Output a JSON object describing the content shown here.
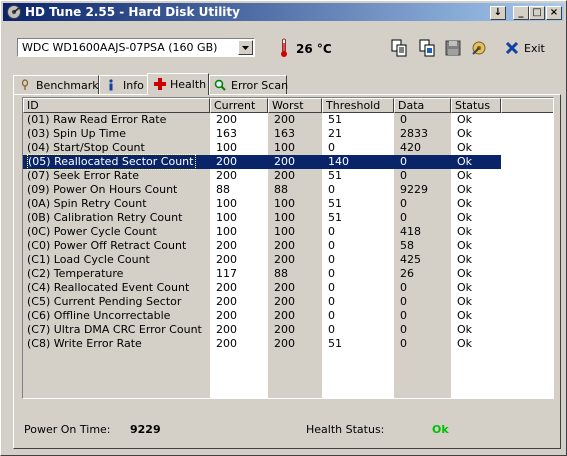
{
  "window": {
    "title": "HD Tune 2.55 - Hard Disk Utility",
    "buttons": [
      "↓",
      "_",
      "□",
      "×"
    ]
  },
  "toolbar": {
    "drive": "WDC WD1600AAJS-07PSA (160 GB)",
    "temperature": "26 °C",
    "exit_label": "Exit",
    "icons": [
      "copy-text-icon",
      "copy-screenshot-icon",
      "save-icon",
      "options-icon"
    ]
  },
  "tabs": [
    {
      "label": "Benchmark",
      "icon": "benchmark-icon"
    },
    {
      "label": "Info",
      "icon": "info-icon"
    },
    {
      "label": "Health",
      "icon": "health-icon",
      "active": true
    },
    {
      "label": "Error Scan",
      "icon": "error-scan-icon"
    }
  ],
  "table": {
    "headers": [
      "ID",
      "Current",
      "Worst",
      "Threshold",
      "Data",
      "Status"
    ],
    "selected_index": 3,
    "rows": [
      [
        "(01) Raw Read Error Rate",
        "200",
        "200",
        "51",
        "0",
        "Ok"
      ],
      [
        "(03) Spin Up Time",
        "163",
        "163",
        "21",
        "2833",
        "Ok"
      ],
      [
        "(04) Start/Stop Count",
        "100",
        "100",
        "0",
        "420",
        "Ok"
      ],
      [
        "(05) Reallocated Sector Count",
        "200",
        "200",
        "140",
        "0",
        "Ok"
      ],
      [
        "(07) Seek Error Rate",
        "200",
        "200",
        "51",
        "0",
        "Ok"
      ],
      [
        "(09) Power On Hours Count",
        "88",
        "88",
        "0",
        "9229",
        "Ok"
      ],
      [
        "(0A) Spin Retry Count",
        "100",
        "100",
        "51",
        "0",
        "Ok"
      ],
      [
        "(0B) Calibration Retry Count",
        "100",
        "100",
        "51",
        "0",
        "Ok"
      ],
      [
        "(0C) Power Cycle Count",
        "100",
        "100",
        "0",
        "418",
        "Ok"
      ],
      [
        "(C0) Power Off Retract Count",
        "200",
        "200",
        "0",
        "58",
        "Ok"
      ],
      [
        "(C1) Load Cycle Count",
        "200",
        "200",
        "0",
        "425",
        "Ok"
      ],
      [
        "(C2) Temperature",
        "117",
        "88",
        "0",
        "26",
        "Ok"
      ],
      [
        "(C4) Reallocated Event Count",
        "200",
        "200",
        "0",
        "0",
        "Ok"
      ],
      [
        "(C5) Current Pending Sector",
        "200",
        "200",
        "0",
        "0",
        "Ok"
      ],
      [
        "(C6) Offline Uncorrectable",
        "200",
        "200",
        "0",
        "0",
        "Ok"
      ],
      [
        "(C7) Ultra DMA CRC Error Count",
        "200",
        "200",
        "0",
        "0",
        "Ok"
      ],
      [
        "(C8) Write Error Rate",
        "200",
        "200",
        "51",
        "0",
        "Ok"
      ]
    ]
  },
  "status": {
    "power_on_label": "Power On Time:",
    "power_on_value": "9229",
    "health_label": "Health Status:",
    "health_value": "Ok",
    "health_color": "#00c000"
  },
  "colors": {
    "title_gradient_start": "#0a246a",
    "selection": "#0a246a",
    "temperature_icon": "#d00000"
  }
}
